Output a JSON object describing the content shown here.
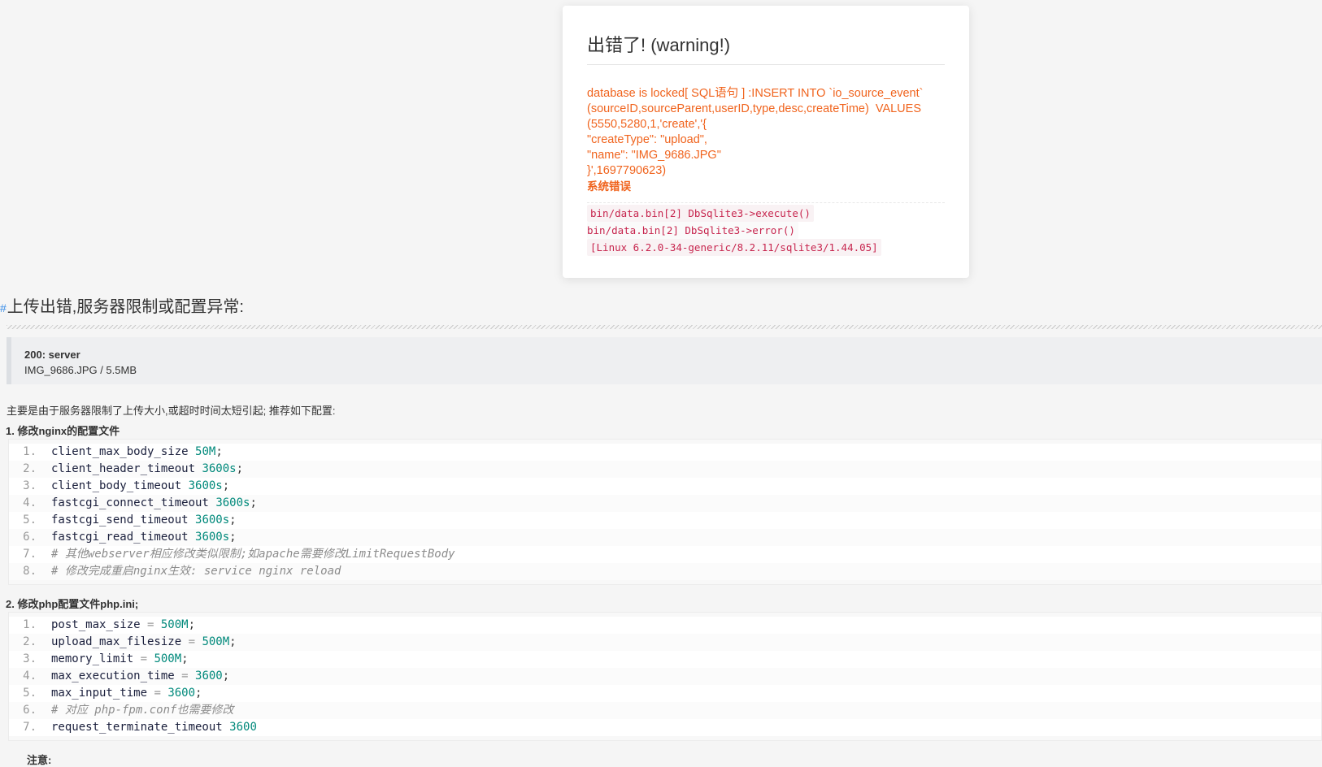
{
  "error": {
    "title": "出错了! (warning!)",
    "message": "database is locked[ SQL语句 ] :INSERT INTO `io_source_event` (sourceID,sourceParent,userID,type,desc,createTime)  VALUES (5550,5280,1,'create','{\n\"createType\": \"upload\",\n\"name\": \"IMG_9686.JPG\"\n}',1697790623)",
    "label": "系统错误",
    "trace": [
      "bin/data.bin[2] DbSqlite3->execute()",
      "bin/data.bin[2] DbSqlite3->error()",
      "[Linux 6.2.0-34-generic/8.2.11/sqlite3/1.44.05]"
    ]
  },
  "upload": {
    "marker": "#",
    "title": "上传出错,服务器限制或配置异常:",
    "status_code": "200: server",
    "status_file": "IMG_9686.JPG / 5.5MB",
    "intro": "主要是由于服务器限制了上传大小,或超时时间太短引起; 推荐如下配置:",
    "step1_title": "1. 修改nginx的配置文件",
    "step2_title": "2. 修改php配置文件php.ini;",
    "note": "注意:"
  },
  "nginx_lines": [
    {
      "no": "1.",
      "key": "client_max_body_size",
      "op": " ",
      "val": "50M",
      "end": ";"
    },
    {
      "no": "2.",
      "key": "client_header_timeout",
      "op": " ",
      "val": "3600s",
      "end": ";"
    },
    {
      "no": "3.",
      "key": "client_body_timeout",
      "op": " ",
      "val": "3600s",
      "end": ";"
    },
    {
      "no": "4.",
      "key": "fastcgi_connect_timeout",
      "op": " ",
      "val": "3600s",
      "end": ";"
    },
    {
      "no": "5.",
      "key": "fastcgi_send_timeout",
      "op": " ",
      "val": "3600s",
      "end": ";"
    },
    {
      "no": "6.",
      "key": "fastcgi_read_timeout",
      "op": " ",
      "val": "3600s",
      "end": ";"
    },
    {
      "no": "7.",
      "comment": "# 其他webserver相应修改类似限制;如apache需要修改LimitRequestBody"
    },
    {
      "no": "8.",
      "comment": "# 修改完成重启nginx生效: service nginx reload"
    }
  ],
  "php_lines": [
    {
      "no": "1.",
      "key": "post_max_size",
      "op": " = ",
      "val": "500M",
      "end": ";"
    },
    {
      "no": "2.",
      "key": "upload_max_filesize",
      "op": " = ",
      "val": "500M",
      "end": ";"
    },
    {
      "no": "3.",
      "key": "memory_limit",
      "op": " = ",
      "val": "500M",
      "end": ";"
    },
    {
      "no": "4.",
      "key": "max_execution_time",
      "op": " = ",
      "val": "3600",
      "end": ";"
    },
    {
      "no": "5.",
      "key": "max_input_time",
      "op": " = ",
      "val": "3600",
      "end": ";"
    },
    {
      "no": "6.",
      "comment": "# 对应 php-fpm.conf也需要修改"
    },
    {
      "no": "7.",
      "key": "request_terminate_timeout",
      "op": " ",
      "val": "3600",
      "end": ""
    }
  ],
  "colors": {
    "error_text": "#f0641e",
    "trace_text": "#c7254e",
    "code_value": "#00897b"
  }
}
